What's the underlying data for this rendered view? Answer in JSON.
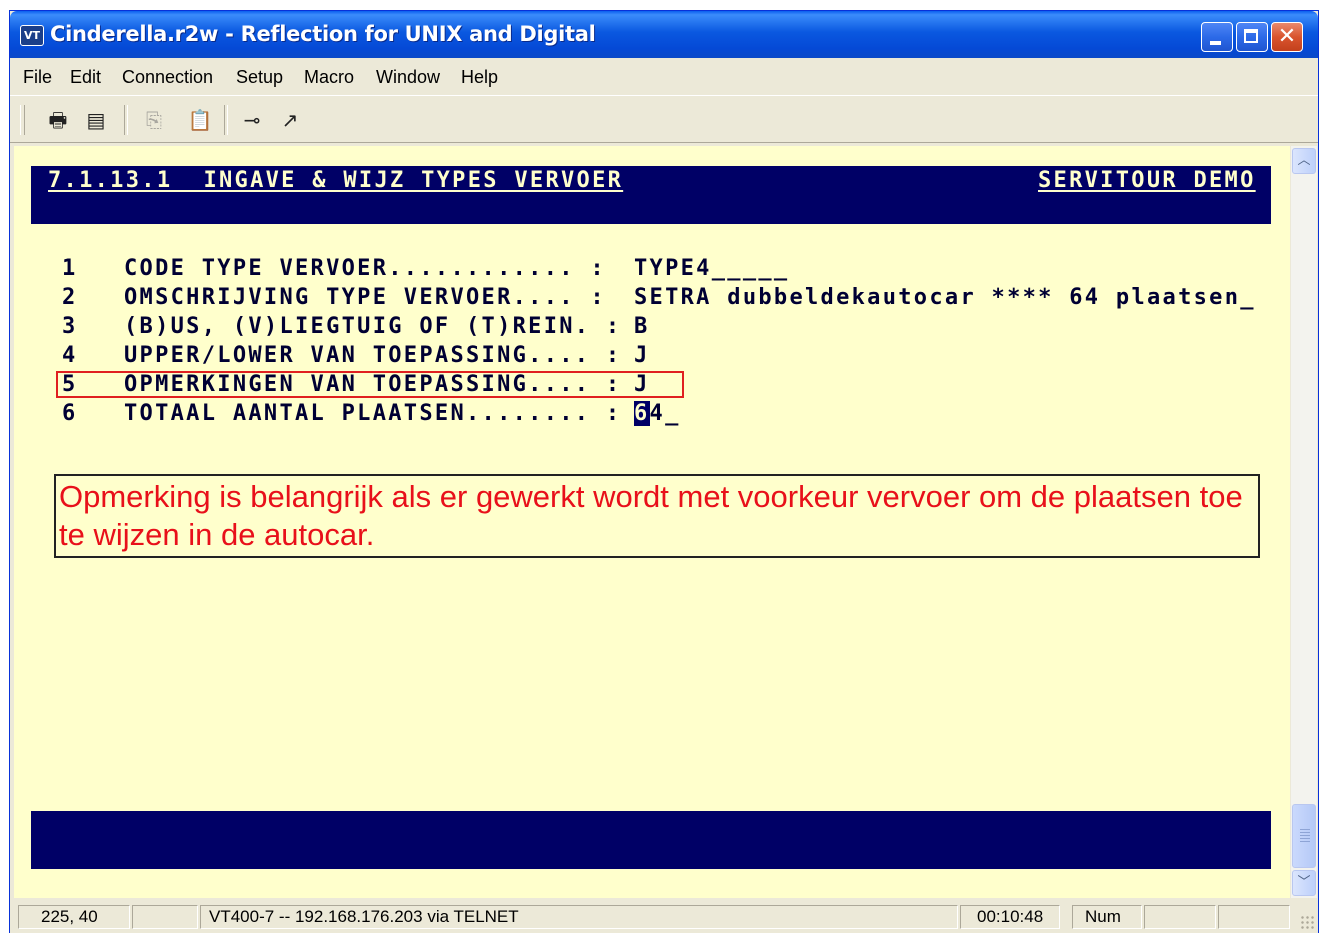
{
  "window": {
    "title": "Cinderella.r2w - Reflection for UNIX and Digital",
    "icon_label": "VT"
  },
  "menu": [
    {
      "label": "File"
    },
    {
      "label": "Edit"
    },
    {
      "label": "Connection"
    },
    {
      "label": "Setup"
    },
    {
      "label": "Macro"
    },
    {
      "label": "Window"
    },
    {
      "label": "Help"
    }
  ],
  "toolbar": {
    "icons": [
      "print-icon",
      "print-screen-icon",
      "copy-icon",
      "paste-icon",
      "connect-icon",
      "macro-record-icon"
    ]
  },
  "terminal": {
    "header_left": "7.1.13.1  INGAVE & WIJZ TYPES VERVOER",
    "header_right": "SERVITOUR DEMO",
    "fields": [
      {
        "num": "1",
        "label": "CODE TYPE VERVOER............ :",
        "value": "TYPE4_____"
      },
      {
        "num": "2",
        "label": "OMSCHRIJVING TYPE VERVOER.... :",
        "value": "SETRA dubbeldekautocar **** 64 plaatsen_"
      },
      {
        "num": "3",
        "label": "(B)US, (V)LIEGTUIG OF (T)REIN. :",
        "value": "B"
      },
      {
        "num": "4",
        "label": "UPPER/LOWER VAN TOEPASSING.... :",
        "value": "J"
      },
      {
        "num": "5",
        "label": "OPMERKINGEN VAN TOEPASSING.... :",
        "value": "J"
      },
      {
        "num": "6",
        "label": "TOTAAL AANTAL PLAATSEN........ :",
        "value_cursor": "6",
        "value_rest": "4_"
      }
    ],
    "note": "Opmerking is belangrijk als er gewerkt wordt met voorkeur vervoer om de plaatsen toe te wijzen in de autocar.",
    "colors": {
      "background": "#ffffcc",
      "bar": "#000066",
      "note": "#e8101a",
      "highlight_border": "#e02020"
    }
  },
  "status": {
    "cursor_pos": "225, 40",
    "connection": "VT400-7 -- 192.168.176.203 via TELNET",
    "time": "00:10:48",
    "num": "Num"
  }
}
